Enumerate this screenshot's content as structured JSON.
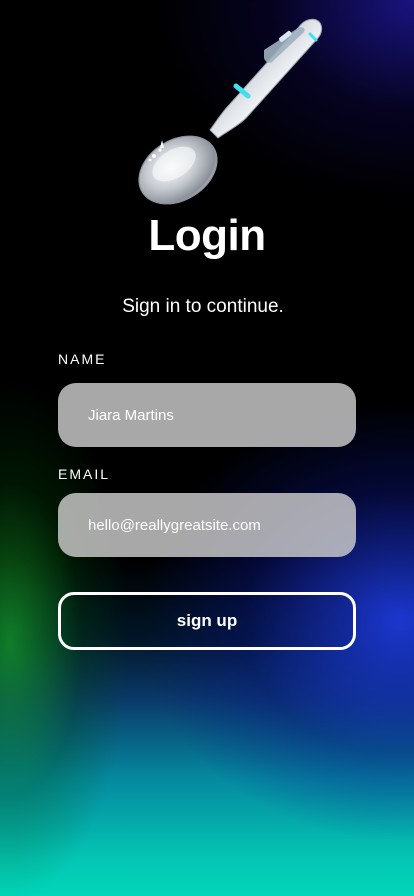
{
  "header": {
    "title": "Login",
    "subtitle": "Sign in to continue."
  },
  "form": {
    "name_label": "NAME",
    "name_value": "Jiara Martins",
    "email_label": "EMAIL",
    "email_value": "hello@reallygreatsite.com",
    "submit_label": "sign up"
  },
  "illustration": {
    "icon": "smart-spoon-icon"
  },
  "colors": {
    "background_top": "#000000",
    "accent_blue": "#2a1ec8",
    "accent_green": "#14a028",
    "background_bottom": "#00d6b8",
    "input_fill": "#cdcdcd"
  }
}
